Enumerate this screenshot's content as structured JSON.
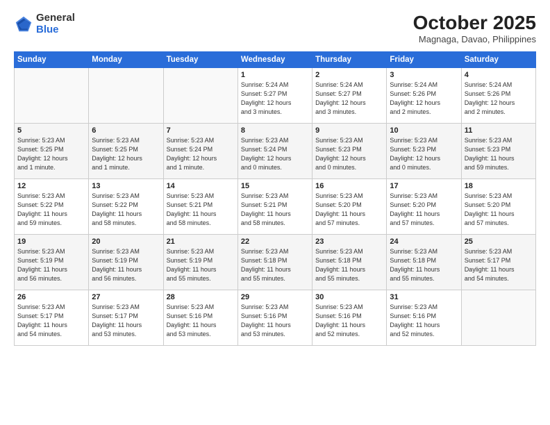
{
  "header": {
    "logo_general": "General",
    "logo_blue": "Blue",
    "month_title": "October 2025",
    "location": "Magnaga, Davao, Philippines"
  },
  "days_of_week": [
    "Sunday",
    "Monday",
    "Tuesday",
    "Wednesday",
    "Thursday",
    "Friday",
    "Saturday"
  ],
  "weeks": [
    [
      {
        "num": "",
        "info": ""
      },
      {
        "num": "",
        "info": ""
      },
      {
        "num": "",
        "info": ""
      },
      {
        "num": "1",
        "info": "Sunrise: 5:24 AM\nSunset: 5:27 PM\nDaylight: 12 hours\nand 3 minutes."
      },
      {
        "num": "2",
        "info": "Sunrise: 5:24 AM\nSunset: 5:27 PM\nDaylight: 12 hours\nand 3 minutes."
      },
      {
        "num": "3",
        "info": "Sunrise: 5:24 AM\nSunset: 5:26 PM\nDaylight: 12 hours\nand 2 minutes."
      },
      {
        "num": "4",
        "info": "Sunrise: 5:24 AM\nSunset: 5:26 PM\nDaylight: 12 hours\nand 2 minutes."
      }
    ],
    [
      {
        "num": "5",
        "info": "Sunrise: 5:23 AM\nSunset: 5:25 PM\nDaylight: 12 hours\nand 1 minute."
      },
      {
        "num": "6",
        "info": "Sunrise: 5:23 AM\nSunset: 5:25 PM\nDaylight: 12 hours\nand 1 minute."
      },
      {
        "num": "7",
        "info": "Sunrise: 5:23 AM\nSunset: 5:24 PM\nDaylight: 12 hours\nand 1 minute."
      },
      {
        "num": "8",
        "info": "Sunrise: 5:23 AM\nSunset: 5:24 PM\nDaylight: 12 hours\nand 0 minutes."
      },
      {
        "num": "9",
        "info": "Sunrise: 5:23 AM\nSunset: 5:23 PM\nDaylight: 12 hours\nand 0 minutes."
      },
      {
        "num": "10",
        "info": "Sunrise: 5:23 AM\nSunset: 5:23 PM\nDaylight: 12 hours\nand 0 minutes."
      },
      {
        "num": "11",
        "info": "Sunrise: 5:23 AM\nSunset: 5:23 PM\nDaylight: 11 hours\nand 59 minutes."
      }
    ],
    [
      {
        "num": "12",
        "info": "Sunrise: 5:23 AM\nSunset: 5:22 PM\nDaylight: 11 hours\nand 59 minutes."
      },
      {
        "num": "13",
        "info": "Sunrise: 5:23 AM\nSunset: 5:22 PM\nDaylight: 11 hours\nand 58 minutes."
      },
      {
        "num": "14",
        "info": "Sunrise: 5:23 AM\nSunset: 5:21 PM\nDaylight: 11 hours\nand 58 minutes."
      },
      {
        "num": "15",
        "info": "Sunrise: 5:23 AM\nSunset: 5:21 PM\nDaylight: 11 hours\nand 58 minutes."
      },
      {
        "num": "16",
        "info": "Sunrise: 5:23 AM\nSunset: 5:20 PM\nDaylight: 11 hours\nand 57 minutes."
      },
      {
        "num": "17",
        "info": "Sunrise: 5:23 AM\nSunset: 5:20 PM\nDaylight: 11 hours\nand 57 minutes."
      },
      {
        "num": "18",
        "info": "Sunrise: 5:23 AM\nSunset: 5:20 PM\nDaylight: 11 hours\nand 57 minutes."
      }
    ],
    [
      {
        "num": "19",
        "info": "Sunrise: 5:23 AM\nSunset: 5:19 PM\nDaylight: 11 hours\nand 56 minutes."
      },
      {
        "num": "20",
        "info": "Sunrise: 5:23 AM\nSunset: 5:19 PM\nDaylight: 11 hours\nand 56 minutes."
      },
      {
        "num": "21",
        "info": "Sunrise: 5:23 AM\nSunset: 5:19 PM\nDaylight: 11 hours\nand 55 minutes."
      },
      {
        "num": "22",
        "info": "Sunrise: 5:23 AM\nSunset: 5:18 PM\nDaylight: 11 hours\nand 55 minutes."
      },
      {
        "num": "23",
        "info": "Sunrise: 5:23 AM\nSunset: 5:18 PM\nDaylight: 11 hours\nand 55 minutes."
      },
      {
        "num": "24",
        "info": "Sunrise: 5:23 AM\nSunset: 5:18 PM\nDaylight: 11 hours\nand 55 minutes."
      },
      {
        "num": "25",
        "info": "Sunrise: 5:23 AM\nSunset: 5:17 PM\nDaylight: 11 hours\nand 54 minutes."
      }
    ],
    [
      {
        "num": "26",
        "info": "Sunrise: 5:23 AM\nSunset: 5:17 PM\nDaylight: 11 hours\nand 54 minutes."
      },
      {
        "num": "27",
        "info": "Sunrise: 5:23 AM\nSunset: 5:17 PM\nDaylight: 11 hours\nand 53 minutes."
      },
      {
        "num": "28",
        "info": "Sunrise: 5:23 AM\nSunset: 5:16 PM\nDaylight: 11 hours\nand 53 minutes."
      },
      {
        "num": "29",
        "info": "Sunrise: 5:23 AM\nSunset: 5:16 PM\nDaylight: 11 hours\nand 53 minutes."
      },
      {
        "num": "30",
        "info": "Sunrise: 5:23 AM\nSunset: 5:16 PM\nDaylight: 11 hours\nand 52 minutes."
      },
      {
        "num": "31",
        "info": "Sunrise: 5:23 AM\nSunset: 5:16 PM\nDaylight: 11 hours\nand 52 minutes."
      },
      {
        "num": "",
        "info": ""
      }
    ]
  ]
}
